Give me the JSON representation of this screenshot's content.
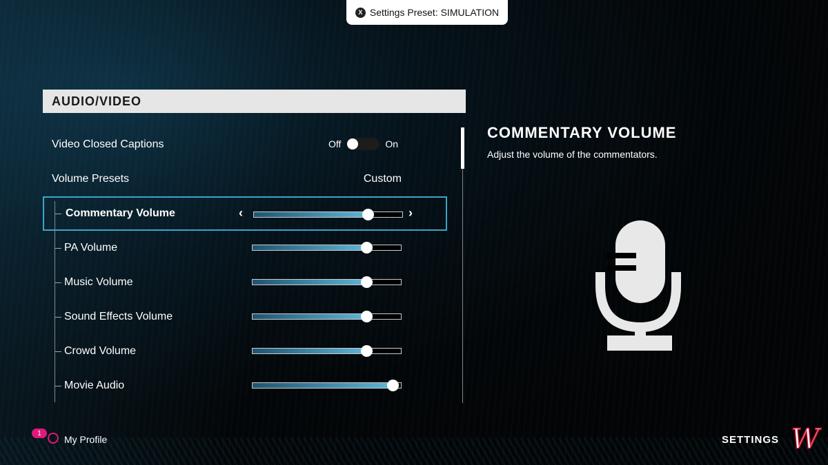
{
  "preset": {
    "button_icon": "X",
    "text": "Settings Preset: SIMULATION"
  },
  "section": {
    "title": "AUDIO/VIDEO"
  },
  "rows": [
    {
      "label": "Video Closed Captions",
      "type": "toggle",
      "off_label": "Off",
      "on_label": "On",
      "value": "Off"
    },
    {
      "label": "Volume Presets",
      "type": "value",
      "value": "Custom"
    },
    {
      "label": "Commentary Volume",
      "type": "slider",
      "value": 0.77,
      "selected": true
    },
    {
      "label": "PA Volume",
      "type": "slider",
      "value": 0.77
    },
    {
      "label": "Music Volume",
      "type": "slider",
      "value": 0.77
    },
    {
      "label": "Sound Effects Volume",
      "type": "slider",
      "value": 0.77
    },
    {
      "label": "Crowd Volume",
      "type": "slider",
      "value": 0.77
    },
    {
      "label": "Movie Audio",
      "type": "slider",
      "value": 0.95
    }
  ],
  "detail": {
    "title": "COMMENTARY VOLUME",
    "description": "Adjust the volume of the commentators.",
    "icon": "microphone-icon"
  },
  "footer": {
    "badge_count": "1",
    "profile_label": "My Profile",
    "settings_label": "SETTINGS",
    "team_logo": "W"
  },
  "colors": {
    "accent": "#3aa6c8",
    "badge": "#e0197a",
    "logo_red": "#c8102e"
  }
}
